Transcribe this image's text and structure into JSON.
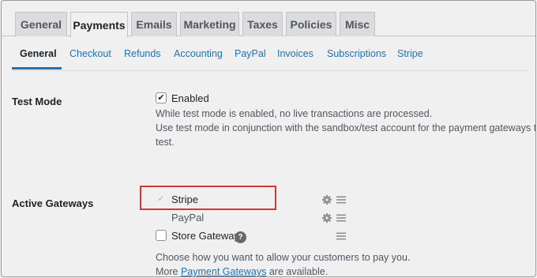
{
  "tabs": [
    {
      "label": "General",
      "active": false
    },
    {
      "label": "Payments",
      "active": true
    },
    {
      "label": "Emails",
      "active": false
    },
    {
      "label": "Marketing",
      "active": false
    },
    {
      "label": "Taxes",
      "active": false
    },
    {
      "label": "Policies",
      "active": false
    },
    {
      "label": "Misc",
      "active": false
    }
  ],
  "subtabs": [
    {
      "label": "General",
      "active": true
    },
    {
      "label": "Checkout"
    },
    {
      "label": "Refunds"
    },
    {
      "label": "Accounting"
    },
    {
      "label": "PayPal"
    },
    {
      "label": "Invoices"
    },
    {
      "label": "Subscriptions"
    },
    {
      "label": "Stripe"
    }
  ],
  "test_mode": {
    "label": "Test Mode",
    "checkbox_label": "Enabled",
    "checked": true,
    "desc_line1": "While test mode is enabled, no live transactions are processed.",
    "desc_line2": "Use test mode in conjunction with the sandbox/test account for the payment gateways to",
    "desc_line3": "test."
  },
  "gateways": {
    "label": "Active Gateways",
    "items": [
      {
        "label": "Stripe",
        "checked": true
      },
      {
        "label": "PayPal",
        "checked": false
      },
      {
        "label": "Store Gateway",
        "checked": false
      }
    ],
    "help_glyph": "?",
    "desc_line1": "Choose how you want to allow your customers to pay you.",
    "desc_more_prefix": "More",
    "desc_more_link": "Payment Gateways",
    "desc_more_suffix": "are available."
  },
  "colors": {
    "accent": "#2271b1",
    "highlight": "#d63638",
    "background": "#f0f0f1"
  }
}
